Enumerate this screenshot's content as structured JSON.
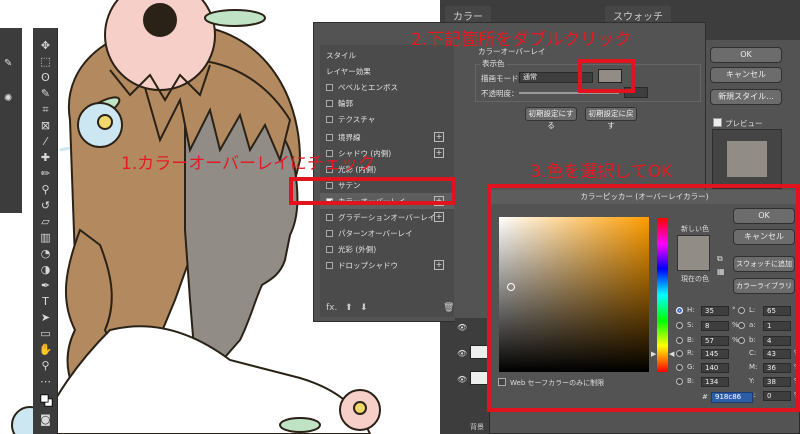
{
  "panels": {
    "color_tab": "カラー",
    "swatches_tab": "スウォッチ"
  },
  "layer_style": {
    "style_header": "スタイル",
    "items": [
      {
        "label": "レイヤー効果",
        "checkbox": false,
        "checked": false,
        "plus": false
      },
      {
        "label": "ベベルとエンボス",
        "checkbox": true,
        "checked": false,
        "plus": false
      },
      {
        "label": "輪郭",
        "checkbox": true,
        "checked": false,
        "plus": false
      },
      {
        "label": "テクスチャ",
        "checkbox": true,
        "checked": false,
        "plus": false
      },
      {
        "label": "境界線",
        "checkbox": true,
        "checked": false,
        "plus": true
      },
      {
        "label": "シャドウ (内側)",
        "checkbox": true,
        "checked": false,
        "plus": true
      },
      {
        "label": "光彩 (内側)",
        "checkbox": true,
        "checked": false,
        "plus": false
      },
      {
        "label": "サテン",
        "checkbox": true,
        "checked": false,
        "plus": false
      },
      {
        "label": "カラーオーバーレイ",
        "checkbox": true,
        "checked": true,
        "plus": true
      },
      {
        "label": "グラデーションオーバーレイ",
        "checkbox": true,
        "checked": false,
        "plus": true
      },
      {
        "label": "パターンオーバーレイ",
        "checkbox": true,
        "checked": false,
        "plus": false
      },
      {
        "label": "光彩 (外側)",
        "checkbox": true,
        "checked": false,
        "plus": false
      },
      {
        "label": "ドロップシャドウ",
        "checkbox": true,
        "checked": false,
        "plus": true
      }
    ],
    "fx_label": "fx.",
    "section_title": "カラーオーバーレイ",
    "group_label": "表示色",
    "blend_mode_label": "描画モード：",
    "blend_mode_value": "通常",
    "opacity_label": "不透明度：",
    "reset_default_button": "初期設定にする",
    "restore_default_button": "初期設定に戻す",
    "ok_button": "OK",
    "cancel_button": "キャンセル",
    "new_style_button": "新規スタイル...",
    "preview_label": "プレビュー",
    "overlay_color": "#918c86"
  },
  "color_picker": {
    "title": "カラーピッカー (オーバーレイカラー)",
    "ok_button": "OK",
    "cancel_button": "キャンセル",
    "add_to_swatch_button": "スウォッチに追加",
    "color_library_button": "カラーライブラリ",
    "new_label": "新しい色",
    "current_label": "現在の色",
    "web_only_label": "Web セーフカラーのみに制限",
    "hsb": [
      {
        "key": "H:",
        "value": "35",
        "unit": "°"
      },
      {
        "key": "S:",
        "value": "8",
        "unit": "%"
      },
      {
        "key": "B:",
        "value": "57",
        "unit": "%"
      }
    ],
    "rgb": [
      {
        "key": "R:",
        "value": "145"
      },
      {
        "key": "G:",
        "value": "140"
      },
      {
        "key": "B:",
        "value": "134"
      }
    ],
    "lab": [
      {
        "key": "L:",
        "value": "65"
      },
      {
        "key": "a:",
        "value": "1"
      },
      {
        "key": "b:",
        "value": "4"
      }
    ],
    "cmyk": [
      {
        "key": "C:",
        "value": "43",
        "unit": "%"
      },
      {
        "key": "M:",
        "value": "36",
        "unit": "%"
      },
      {
        "key": "Y:",
        "value": "38",
        "unit": "%"
      },
      {
        "key": "K:",
        "value": "0",
        "unit": "%"
      }
    ],
    "hex_prefix": "#",
    "hex_value": "918c86",
    "selected_color": "#918c86"
  },
  "annotations": {
    "step1": "1.カラーオーバーレイにチェック",
    "step2": "2.下記箇所をダブルクリック",
    "step3": "3.色を選択してOK",
    "accent": "#e0131f"
  },
  "layers": {
    "background_label": "背景"
  }
}
